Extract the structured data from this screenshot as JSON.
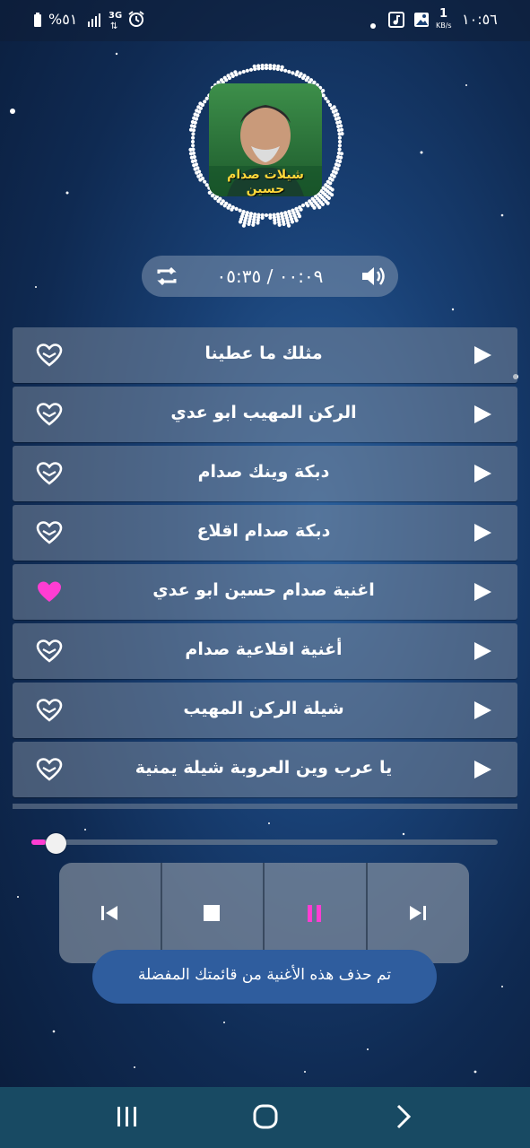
{
  "status_bar": {
    "time": "١٠:٥٦",
    "net_speed_value": "1",
    "net_speed_unit": "KB/s",
    "battery": "%٥١",
    "network_type": "3G"
  },
  "player": {
    "cover_title": "شيلات صدام حسين",
    "time_display": "٠٠:٠٩ / ٠٥:٣٥",
    "progress": 0.03
  },
  "songs": [
    {
      "title": "مثلك ما عطينا",
      "favorite": false
    },
    {
      "title": "الركن المهيب ابو عدي",
      "favorite": false
    },
    {
      "title": "دبكة وينك صدام",
      "favorite": false
    },
    {
      "title": "دبكة صدام اقلاع",
      "favorite": false
    },
    {
      "title": "اغنية صدام حسين ابو عدي",
      "favorite": true
    },
    {
      "title": "أغنية اقلاعية صدام",
      "favorite": false
    },
    {
      "title": "شيلة الركن المهيب",
      "favorite": false
    },
    {
      "title": "يا عرب وين العروبة شيلة يمنية",
      "favorite": false
    }
  ],
  "toast": {
    "message": "تم حذف هذه الأغنية من قائمتك المفضلة"
  },
  "colors": {
    "accent_pink": "#ff3dd2",
    "toast_bg": "#2f5d9e",
    "nav_bg": "#184a63"
  },
  "icons": {
    "repeat": "repeat-icon",
    "volume": "volume-icon",
    "play": "play-icon",
    "heart_outline": "heart-outline-icon",
    "heart_filled": "heart-filled-icon",
    "previous": "skip-previous-icon",
    "stop": "stop-icon",
    "pause": "pause-icon",
    "next": "skip-next-icon",
    "nav_recents": "recents-icon",
    "nav_home": "home-icon",
    "nav_back": "back-icon"
  }
}
